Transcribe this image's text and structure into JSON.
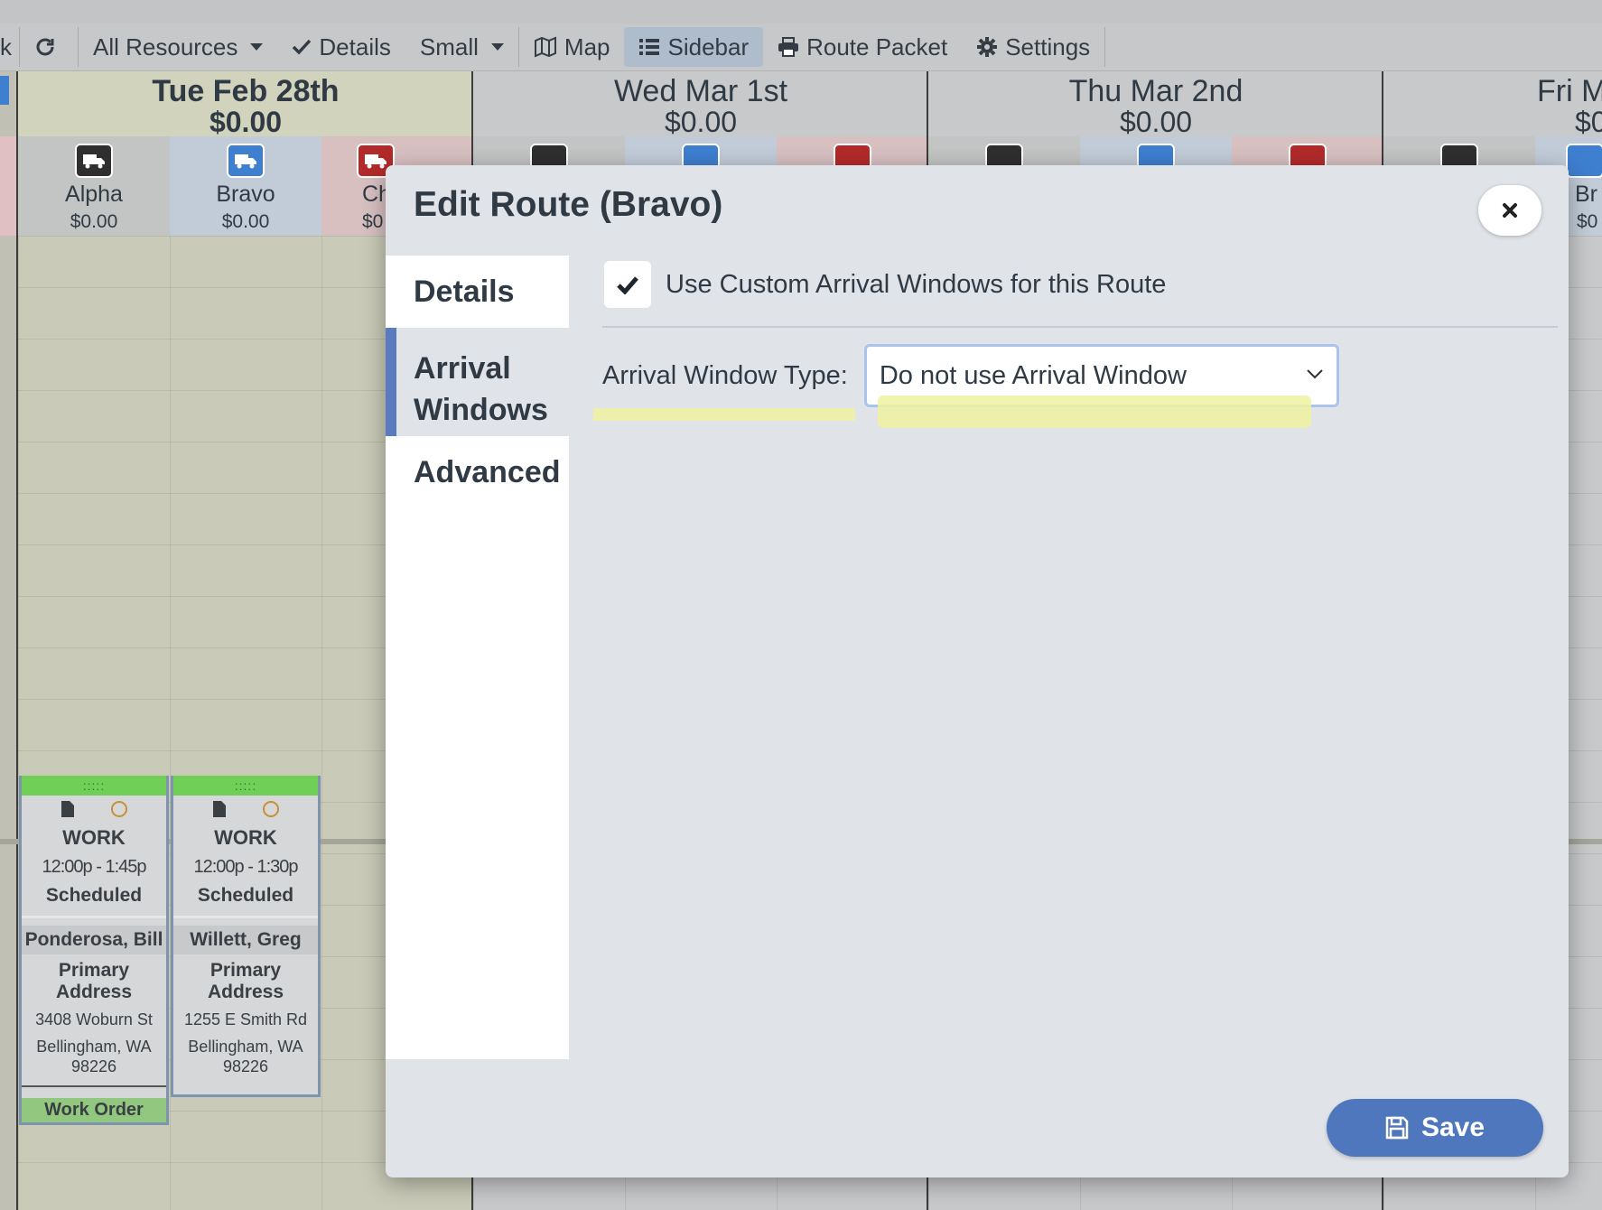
{
  "toolbar": {
    "cut_label": "k",
    "all_resources": "All Resources",
    "details": "Details",
    "size": "Small",
    "map": "Map",
    "sidebar": "Sidebar",
    "route_packet": "Route Packet",
    "settings": "Settings"
  },
  "days": [
    {
      "date": "Tue Feb 28th",
      "amount": "$0.00"
    },
    {
      "date": "Wed Mar 1st",
      "amount": "$0.00"
    },
    {
      "date": "Thu Mar 2nd",
      "amount": "$0.00"
    },
    {
      "date": "Fri M",
      "amount": "$0"
    }
  ],
  "resources": [
    {
      "name": "Alpha",
      "amount": "$0.00",
      "color": "#2f2f2f"
    },
    {
      "name": "Bravo",
      "amount": "$0.00",
      "color": "#3f7fd0"
    },
    {
      "name": "Ch",
      "amount": "$0",
      "color": "#b32a2a"
    }
  ],
  "partial_resource": {
    "name": "Br",
    "amount": "$0"
  },
  "cards": [
    {
      "type": "WORK",
      "time": "12:00p - 1:45p",
      "status": "Scheduled",
      "customer": "Ponderosa, Bill",
      "address_label": "Primary Address",
      "street": "3408 Woburn St",
      "city": "Bellingham, WA 98226",
      "footer": "Work Order"
    },
    {
      "type": "WORK",
      "time": "12:00p - 1:30p",
      "status": "Scheduled",
      "customer": "Willett, Greg",
      "address_label": "Primary Address",
      "street": "1255 E Smith Rd",
      "city": "Bellingham, WA 98226"
    }
  ],
  "modal": {
    "title": "Edit Route (Bravo)",
    "tabs": {
      "details": "Details",
      "arrival_line1": "Arrival",
      "arrival_line2": "Windows",
      "advanced": "Advanced"
    },
    "checkbox_label": "Use Custom Arrival Windows for this Route",
    "checkbox_checked": true,
    "arrival_type_label": "Arrival Window Type:",
    "arrival_type_value": "Do not use Arrival Window",
    "save_label": "Save"
  },
  "colors": {
    "accent": "#4f77bd",
    "tab_indicator": "#5a7bbd",
    "highlighter": "#eff2a0",
    "grip_green": "#6fcf57"
  }
}
